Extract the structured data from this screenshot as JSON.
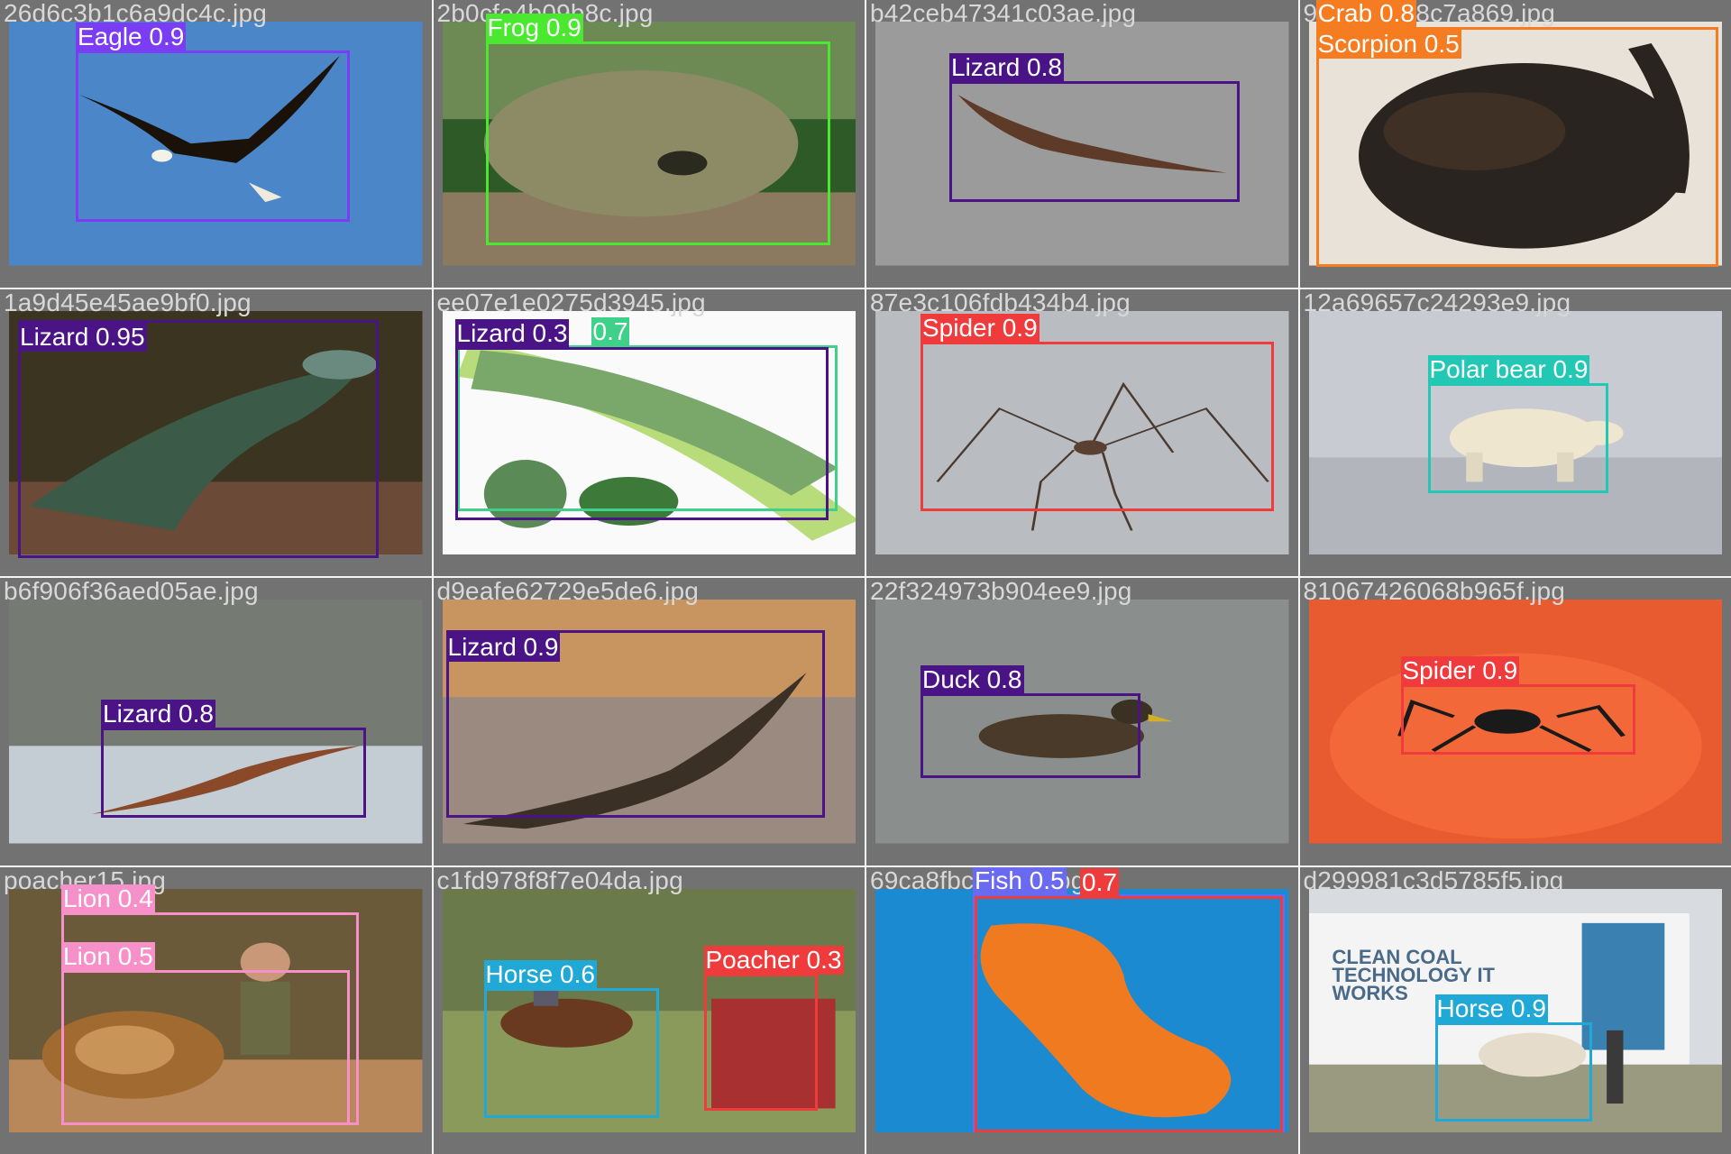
{
  "tiles": [
    {
      "filename": "26d6c3b1c6a9dc4c.jpg",
      "detections": [
        {
          "label": "Eagle 0.9",
          "class": "eagle",
          "color": "#7b3df4"
        }
      ]
    },
    {
      "filename": "2b0cfe4b09b8c.jpg",
      "detections": [
        {
          "label": "Frog 0.9",
          "class": "frog",
          "color": "#4be830"
        }
      ]
    },
    {
      "filename": "b42ceb47341c03ae.jpg",
      "detections": [
        {
          "label": "Lizard 0.8",
          "class": "lizard",
          "color": "#4a1487"
        }
      ]
    },
    {
      "filename": "9c4ee7f8f8c7a869.jpg",
      "detections": [
        {
          "label": "Crab 0.8",
          "class": "crab",
          "color": "#f57c20"
        },
        {
          "label": "Scorpion 0.5",
          "class": "scorpion",
          "color": "#f57c20"
        }
      ]
    },
    {
      "filename": "1a9d45e45ae9bf0.jpg",
      "detections": [
        {
          "label": "Lizard 0.95",
          "class": "lizard",
          "color": "#4a1487"
        }
      ]
    },
    {
      "filename": "ee07e1e0275d3945.jpg",
      "detections": [
        {
          "label": "Lizard 0.3",
          "class": "lizard",
          "color": "#4a1487"
        },
        {
          "label": "0.7",
          "class": "caterpillar",
          "color": "#3fd08a"
        }
      ]
    },
    {
      "filename": "87e3c106fdb434b4.jpg",
      "detections": [
        {
          "label": "Spider 0.9",
          "class": "spider",
          "color": "#ef3b3b"
        }
      ]
    },
    {
      "filename": "12a69657c24293e9.jpg",
      "detections": [
        {
          "label": "Polar bear 0.9",
          "class": "polar-bear",
          "color": "#22c8b3"
        }
      ]
    },
    {
      "filename": "b6f906f36aed05ae.jpg",
      "detections": [
        {
          "label": "Lizard 0.8",
          "class": "lizard",
          "color": "#4a1487"
        }
      ]
    },
    {
      "filename": "d9eafe62729e5de6.jpg",
      "detections": [
        {
          "label": "Lizard 0.9",
          "class": "lizard",
          "color": "#4a1487"
        }
      ]
    },
    {
      "filename": "22f324973b904ee9.jpg",
      "detections": [
        {
          "label": "Duck 0.8",
          "class": "duck",
          "color": "#4a1487"
        }
      ]
    },
    {
      "filename": "81067426068b965f.jpg",
      "detections": [
        {
          "label": "Spider 0.9",
          "class": "spider",
          "color": "#ef3b3b"
        }
      ]
    },
    {
      "filename": "poacher15.jpg",
      "detections": [
        {
          "label": "Lion 0.4",
          "class": "lion",
          "color": "#f590c8"
        },
        {
          "label": "Lion 0.5",
          "class": "lion",
          "color": "#f590c8"
        }
      ]
    },
    {
      "filename": "c1fd978f8f7e04da.jpg",
      "detections": [
        {
          "label": "Horse 0.6",
          "class": "horse",
          "color": "#20a9d6"
        },
        {
          "label": "Poacher 0.3",
          "class": "poacher",
          "color": "#ef3b3b"
        }
      ]
    },
    {
      "filename": "69ca8fbcaec33.jpg",
      "detections": [
        {
          "label": "Fish 0.5",
          "class": "fish",
          "color": "#6a6af0"
        },
        {
          "label": "0.7",
          "class": "other",
          "color": "#ef3b3b"
        }
      ]
    },
    {
      "filename": "d299981c3d5785f5.jpg",
      "detections": [
        {
          "label": "Horse 0.9",
          "class": "horse",
          "color": "#20a9d6"
        }
      ]
    }
  ],
  "truck_text": "CLEAN COAL TECHNOLOGY IT WORKS"
}
